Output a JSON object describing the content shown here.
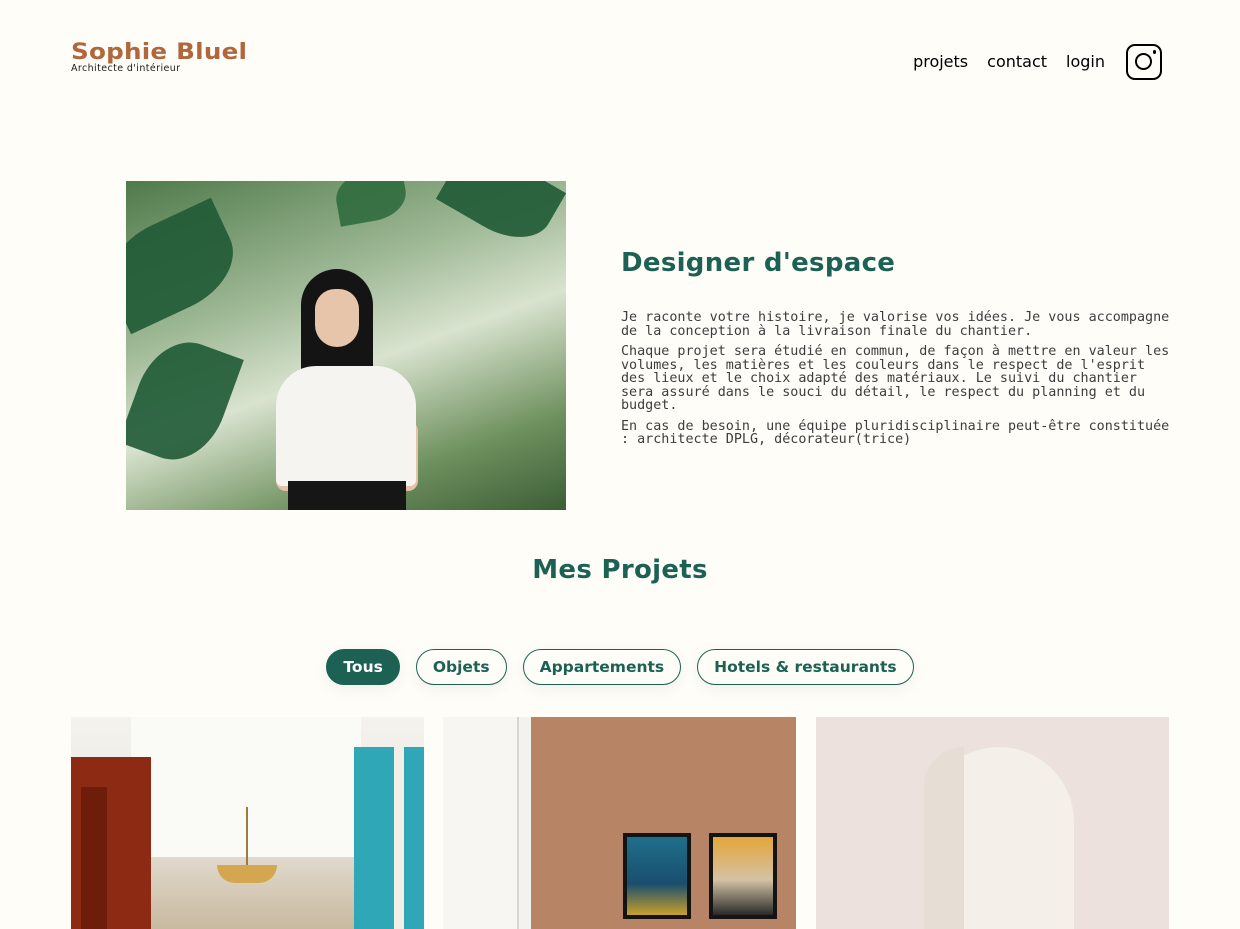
{
  "header": {
    "logo_name": "Sophie Bluel",
    "logo_subtitle": "Architecte d'intérieur",
    "nav": [
      {
        "label": "projets"
      },
      {
        "label": "contact"
      },
      {
        "label": "login"
      }
    ],
    "social_icon": "instagram-icon"
  },
  "intro": {
    "title": "Designer d'espace",
    "paragraphs": [
      "Je raconte votre histoire, je valorise vos idées. Je vous accompagne de la conception à la livraison finale du chantier.",
      "Chaque projet sera étudié en commun, de façon à mettre en valeur les volumes, les matières et les couleurs dans le respect de l'esprit des lieux et le choix adapté des matériaux. Le suivi du chantier sera assuré dans le souci du détail, le respect du planning et du budget.",
      "En cas de besoin, une équipe pluridisciplinaire peut-être constituée : architecte DPLG, décorateur(trice)"
    ]
  },
  "projects": {
    "title": "Mes Projets",
    "filters": [
      {
        "label": "Tous",
        "active": true
      },
      {
        "label": "Objets",
        "active": false
      },
      {
        "label": "Appartements",
        "active": false
      },
      {
        "label": "Hotels & restaurants",
        "active": false
      }
    ]
  },
  "colors": {
    "accent": "#1d6154",
    "logo": "#b1663c",
    "background": "#fffdf8"
  }
}
